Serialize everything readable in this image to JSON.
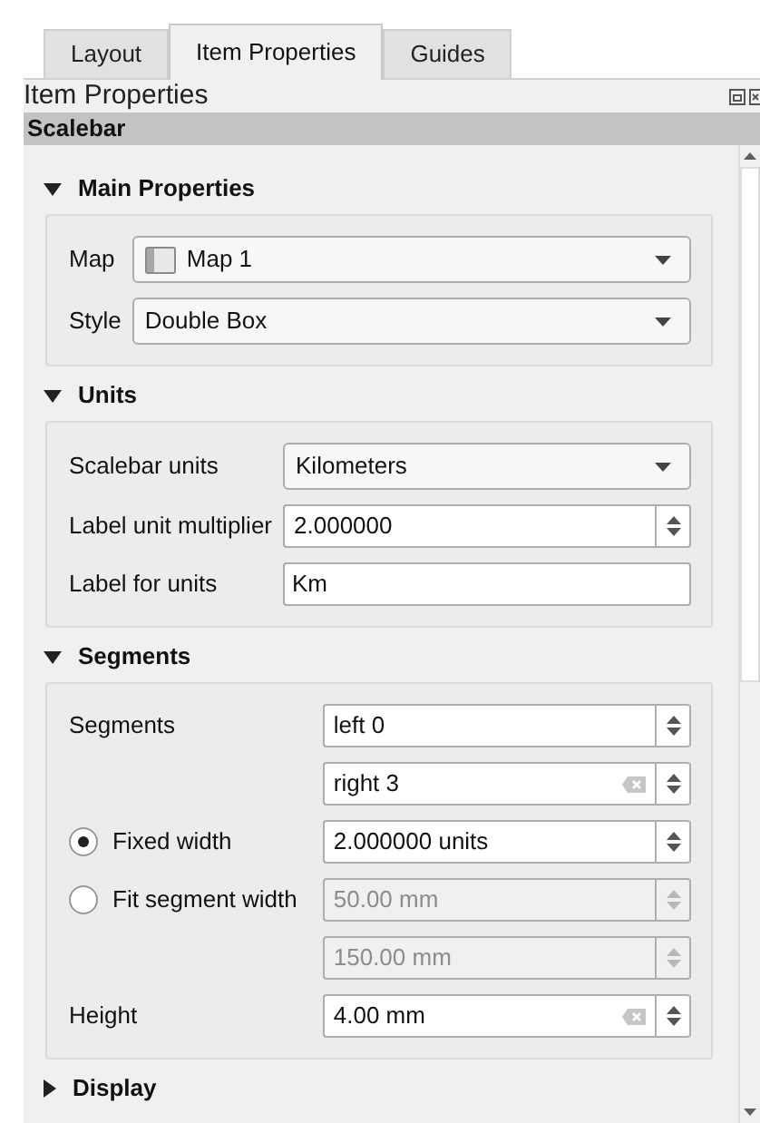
{
  "tabs": [
    {
      "label": "Layout",
      "selected": false
    },
    {
      "label": "Item Properties",
      "selected": true
    },
    {
      "label": "Guides",
      "selected": false
    }
  ],
  "panel": {
    "title": "Item Properties",
    "item_type": "Scalebar"
  },
  "sections": [
    {
      "title": "Main Properties",
      "expanded": true,
      "rows": [
        {
          "kind": "combo",
          "label": "Map",
          "value": "Map 1",
          "map_icon": true
        },
        {
          "kind": "combo",
          "label": "Style",
          "value": "Double Box"
        }
      ]
    },
    {
      "title": "Units",
      "expanded": true,
      "rows": [
        {
          "kind": "combo",
          "label": "Scalebar units",
          "value": "Kilometers"
        },
        {
          "kind": "spin",
          "label": "Label unit multiplier",
          "value": "2.000000"
        },
        {
          "kind": "text",
          "label": "Label for units",
          "value": "Km"
        }
      ]
    },
    {
      "title": "Segments",
      "expanded": true,
      "rows": [
        {
          "kind": "spin",
          "label": "Segments",
          "value": "left 0"
        },
        {
          "kind": "spin",
          "value": "right 3",
          "clearable": true
        },
        {
          "kind": "radio",
          "label": "Fixed width",
          "selected": true,
          "value": "2.000000 units"
        },
        {
          "kind": "radio",
          "label": "Fit segment width",
          "selected": false,
          "value": "50.00 mm",
          "disabled": true
        },
        {
          "kind": "spin",
          "value": "150.00 mm",
          "disabled": true
        },
        {
          "kind": "spin",
          "label": "Height",
          "value": "4.00 mm",
          "clearable": true
        }
      ]
    },
    {
      "title": "Display",
      "expanded": false
    }
  ]
}
